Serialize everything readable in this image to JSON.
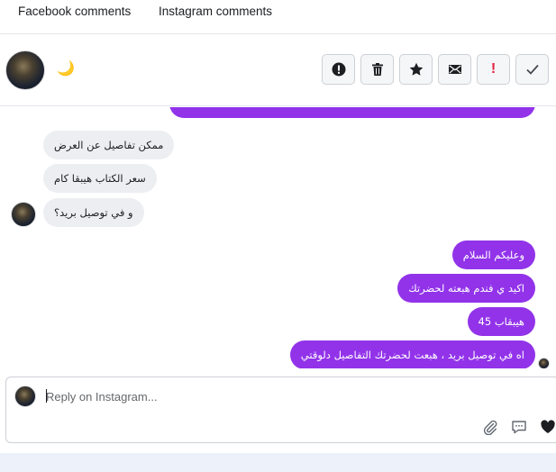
{
  "tabs": [
    "Facebook comments",
    "Instagram comments"
  ],
  "header": {
    "status_emoji": "🌙"
  },
  "actions": [
    {
      "name": "alert-icon-button",
      "icon": "alert-circle-icon"
    },
    {
      "name": "delete-button",
      "icon": "trash-icon"
    },
    {
      "name": "star-button",
      "icon": "star-icon"
    },
    {
      "name": "mail-button",
      "icon": "envelope-icon"
    },
    {
      "name": "mark-important-button",
      "icon": "exclamation-icon",
      "text": "!"
    },
    {
      "name": "done-button",
      "icon": "check-icon"
    }
  ],
  "messages": {
    "incoming": [
      "ممكن تفاصيل عن العرض",
      "سعر الكتاب هيبقا كام",
      "و في توصيل بريد؟"
    ],
    "outgoing": [
      "وعليكم السلام",
      "اكيد ي فندم هبعته لحضرتك",
      "هيبقاب 45",
      "اه في توصيل بريد ، هبعت لحضرتك التفاصيل دلوقتي"
    ]
  },
  "reply": {
    "placeholder": "Reply on Instagram..."
  },
  "colors": {
    "outgoing_bubble": "#9233ea",
    "incoming_bubble": "#eceef1",
    "accent_red": "#e41e3f"
  }
}
